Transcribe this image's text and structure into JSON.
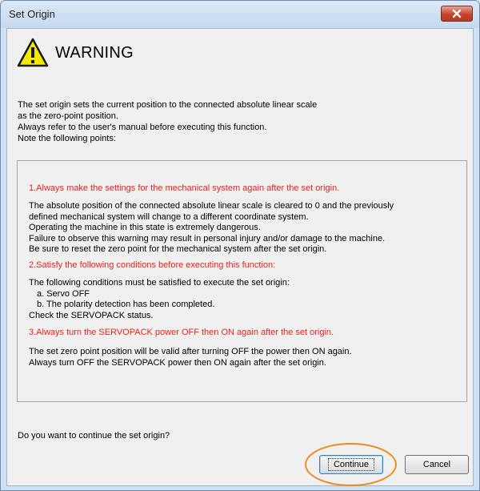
{
  "window": {
    "title": "Set Origin"
  },
  "warning": {
    "title": "WARNING",
    "icon": "warning-triangle-icon"
  },
  "intro": {
    "lines": [
      "The set origin sets the current position to the connected absolute linear scale",
      "as the zero-point position.",
      "Always refer to the user's manual before executing this function.",
      "Note the following points:"
    ]
  },
  "sections": [
    {
      "heading": "1.Always make the settings for the mechanical system again after the set origin.",
      "lines": [
        "The absolute position of the connected absolute linear scale is cleared to 0 and the previously",
        "defined mechanical system will change to a different coordinate system.",
        "Operating the machine in this state is extremely dangerous.",
        "Failure to observe this warning may result in personal injury and/or damage to the machine.",
        "Be sure to reset the zero point for the mechanical system after the set origin."
      ]
    },
    {
      "heading": "2.Satisfy the following conditions before executing this function:",
      "lines": [
        "The following conditions must be satisfied to execute the set origin:",
        "a. Servo OFF",
        "b. The polarity detection has been completed.",
        "Check the SERVOPACK status."
      ]
    },
    {
      "heading": "3.Always turn the SERVOPACK power OFF then ON again after the set origin.",
      "lines": [
        "The set zero point position will be valid after turning OFF the power then ON again.",
        "Always turn OFF the SERVOPACK power then ON again after the set origin."
      ]
    }
  ],
  "question": "Do you want to continue the set origin?",
  "buttons": {
    "continue": "Continue",
    "cancel": "Cancel"
  },
  "colors": {
    "section_heading": "#e8211c",
    "highlight": "#f08a1c",
    "close_button": "#c7442f"
  }
}
